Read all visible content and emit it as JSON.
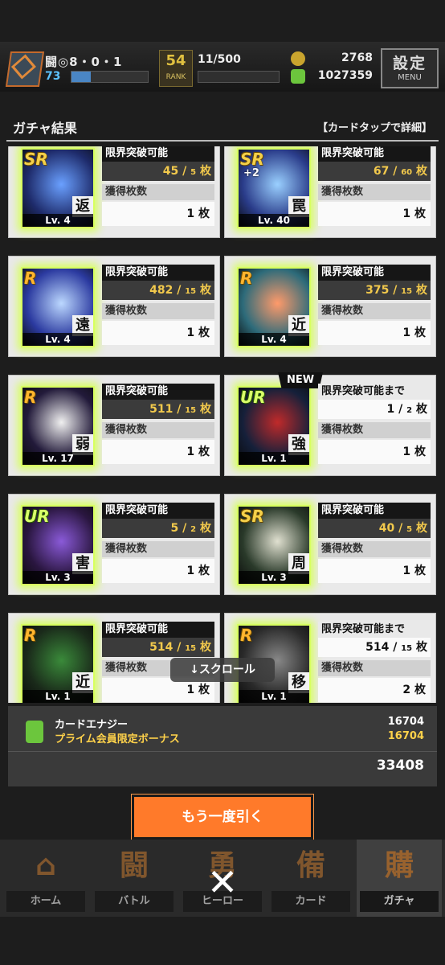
{
  "status": {
    "player_name": "闘◎8・0・1",
    "level": "73",
    "level_progress": 0.25,
    "rank": "54",
    "rank_label": "RANK",
    "stamina": "11/500",
    "gold": "2768",
    "energy": "1027359",
    "menu_label": "設定",
    "menu_sub": "MENU"
  },
  "panel": {
    "title": "ガチャ結果",
    "hint": "【カードタップで詳細】"
  },
  "labels": {
    "limit_break": "限界突破可能",
    "limit_break_until": "限界突破可能まで",
    "obtained": "獲得枚数",
    "unit": "枚",
    "new": "NEW"
  },
  "cards": [
    {
      "rarity": "SR",
      "plus": "",
      "kanji": "返",
      "level": "Lv. 4",
      "status": "限界突破可能",
      "count_a": "45",
      "count_b": "5",
      "obtained": "1",
      "is_new": false
    },
    {
      "rarity": "SR",
      "plus": "+2",
      "kanji": "罠",
      "level": "Lv. 40",
      "status": "限界突破可能",
      "count_a": "67",
      "count_b": "60",
      "obtained": "1",
      "is_new": false
    },
    {
      "rarity": "R",
      "plus": "",
      "kanji": "遠",
      "level": "Lv. 4",
      "status": "限界突破可能",
      "count_a": "482",
      "count_b": "15",
      "obtained": "1",
      "is_new": false
    },
    {
      "rarity": "R",
      "plus": "",
      "kanji": "近",
      "level": "Lv. 4",
      "status": "限界突破可能",
      "count_a": "375",
      "count_b": "15",
      "obtained": "1",
      "is_new": false
    },
    {
      "rarity": "R",
      "plus": "",
      "kanji": "弱",
      "level": "Lv. 17",
      "status": "限界突破可能",
      "count_a": "511",
      "count_b": "15",
      "obtained": "1",
      "is_new": false
    },
    {
      "rarity": "UR",
      "plus": "",
      "kanji": "強",
      "level": "Lv. 1",
      "status": "限界突破可能まで",
      "count_a": "1",
      "count_b": "2",
      "obtained": "1",
      "is_new": true
    },
    {
      "rarity": "UR",
      "plus": "",
      "kanji": "害",
      "level": "Lv. 3",
      "status": "限界突破可能",
      "count_a": "5",
      "count_b": "2",
      "obtained": "1",
      "is_new": false
    },
    {
      "rarity": "SR",
      "plus": "",
      "kanji": "周",
      "level": "Lv. 3",
      "status": "限界突破可能",
      "count_a": "40",
      "count_b": "5",
      "obtained": "1",
      "is_new": false
    },
    {
      "rarity": "R",
      "plus": "",
      "kanji": "近",
      "level": "Lv. 1",
      "status": "限界突破可能",
      "count_a": "514",
      "count_b": "15",
      "obtained": "1",
      "is_new": false
    },
    {
      "rarity": "R",
      "plus": "",
      "kanji": "移",
      "level": "Lv. 1",
      "status": "限界突破可能まで",
      "count_a": "514",
      "count_b": "15",
      "obtained": "2",
      "is_new": false
    }
  ],
  "scroll_hint": "↓スクロール",
  "summary": {
    "line1_label": "カードエナジー",
    "line1_value": "16704",
    "line2_label": "プライム会員限定ボーナス",
    "line2_value": "16704",
    "total": "33408"
  },
  "retry_label": "もう一度引く",
  "nav": [
    {
      "label": "ホーム",
      "icon": "home-icon",
      "glyph": "⌂"
    },
    {
      "label": "バトル",
      "icon": "battle-icon",
      "glyph": "闘"
    },
    {
      "label": "ヒーロー",
      "icon": "hero-icon",
      "glyph": "勇"
    },
    {
      "label": "カード",
      "icon": "card-icon",
      "glyph": "備"
    },
    {
      "label": "ガチャ",
      "icon": "gacha-icon",
      "glyph": "購"
    }
  ],
  "close_glyph": "✕",
  "colors": {
    "accent_orange": "#ff7a2a",
    "glow_green": "#d8ff60",
    "gold_text": "#f2c94c",
    "bonus_yellow": "#ffd24a"
  }
}
